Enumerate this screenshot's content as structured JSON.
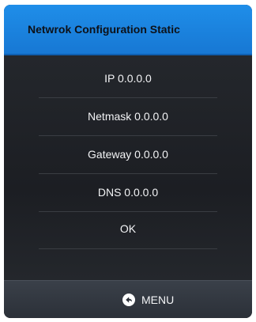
{
  "title": "Netwrok Configuration Static",
  "menu_items": [
    {
      "label": "IP 0.0.0.0"
    },
    {
      "label": "Netmask 0.0.0.0"
    },
    {
      "label": "Gateway 0.0.0.0"
    },
    {
      "label": "DNS 0.0.0.0"
    },
    {
      "label": "OK"
    }
  ],
  "footer": {
    "menu_label": "MENU",
    "menu_icon": "back-arrow-icon"
  },
  "colors": {
    "title_bar": "#1a85e0",
    "background": "#1f2126",
    "text": "#f2f3f5"
  }
}
